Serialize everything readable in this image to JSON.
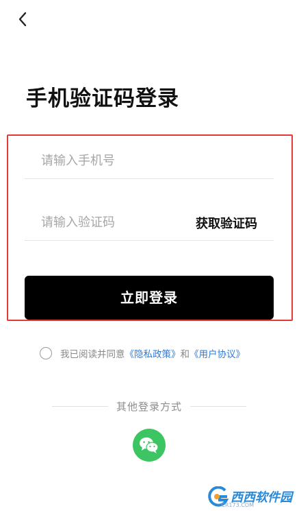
{
  "header": {
    "back_icon": "chevron-left-icon"
  },
  "title": "手机验证码登录",
  "form": {
    "phone_placeholder": "请输入手机号",
    "phone_value": "",
    "code_placeholder": "请输入验证码",
    "code_value": "",
    "get_code_label": "获取验证码",
    "login_label": "立即登录"
  },
  "agreement": {
    "prefix": "我已阅读并同意",
    "privacy_link": "《隐私政策》",
    "and": "和",
    "user_link": "《用户协议》"
  },
  "other_login": {
    "label": "其他登录方式",
    "wechat_icon": "wechat-icon"
  },
  "watermark": {
    "text": "西西软件园",
    "sub": "CR173.COM"
  },
  "colors": {
    "accent": "#000000",
    "link": "#2d7bd6",
    "wechat": "#3ec563",
    "highlight": "#e53935"
  }
}
